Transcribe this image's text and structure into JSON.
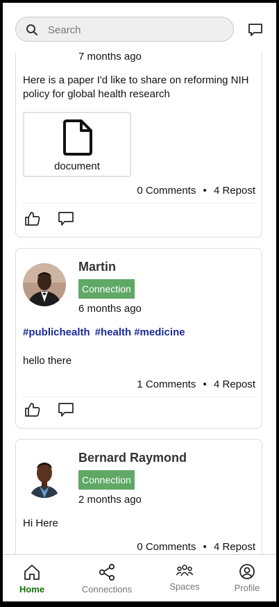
{
  "search": {
    "placeholder": "Search"
  },
  "posts": [
    {
      "time": "7 months ago",
      "text": "Here is a paper I'd like to share on reforming NIH policy for global health research",
      "attachment_label": "document",
      "comments": "0 Comments",
      "reposts": "4 Repost"
    },
    {
      "author": "Martin",
      "badge": "Connection",
      "time": "6 months ago",
      "tags": [
        "#publichealth",
        "#health",
        "#medicine"
      ],
      "text": "hello there",
      "comments": "1 Comments",
      "reposts": "4 Repost"
    },
    {
      "author": "Bernard Raymond",
      "badge": "Connection",
      "time": "2 months ago",
      "text": "Hi Here",
      "comments": "0 Comments",
      "reposts": "4 Repost"
    }
  ],
  "meta_separator": "•",
  "nav": [
    {
      "label": "Home",
      "icon": "home-icon",
      "active": true
    },
    {
      "label": "Connections",
      "icon": "share-nodes-icon",
      "active": false
    },
    {
      "label": "Spaces",
      "icon": "group-icon",
      "active": false
    },
    {
      "label": "Profile",
      "icon": "user-circle-icon",
      "active": false
    }
  ],
  "colors": {
    "accent": "#16700f",
    "badge": "#5fa865",
    "hashtag": "#1b2a96"
  }
}
